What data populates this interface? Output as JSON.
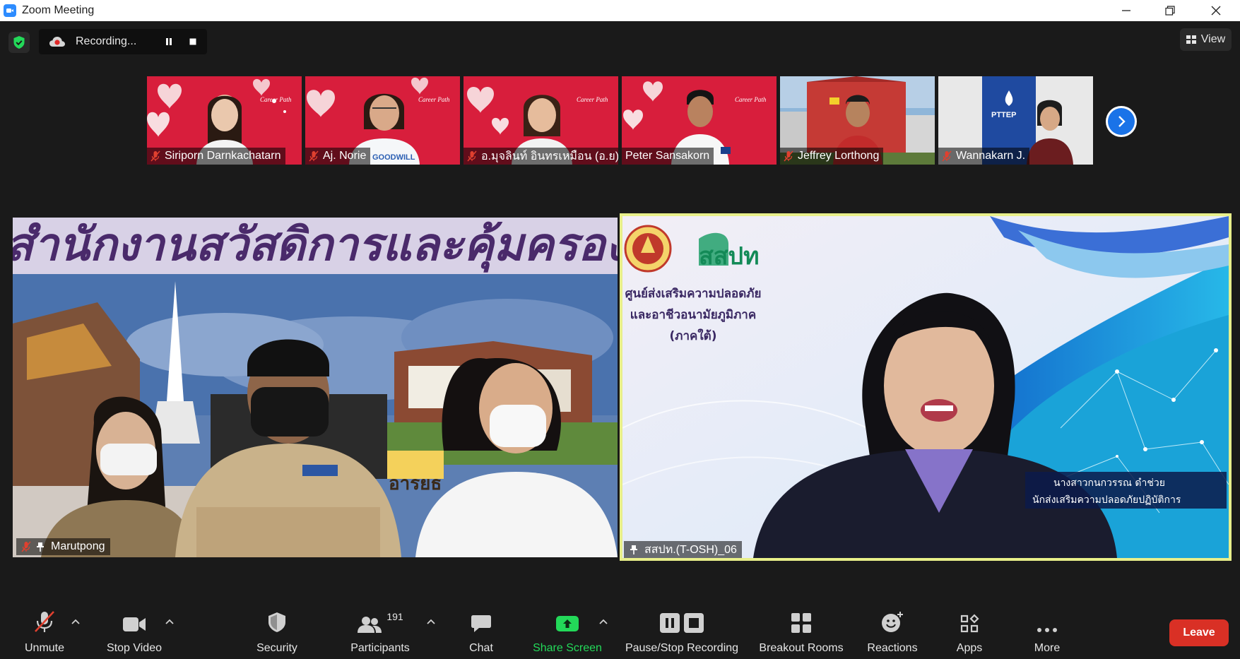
{
  "window": {
    "title": "Zoom Meeting"
  },
  "recording": {
    "status": "Recording..."
  },
  "view_button": {
    "label": "View"
  },
  "participants_strip": [
    {
      "name": "Siriporn Darnkachatarn",
      "muted": true
    },
    {
      "name": "Aj. Norie",
      "muted": true
    },
    {
      "name": "อ.มุจลินท์ อินทรเหมือน (อ.ย)",
      "muted": true
    },
    {
      "name": "Peter Sansakorn",
      "muted": false
    },
    {
      "name": "Jeffrey Lorthong",
      "muted": true
    },
    {
      "name": "Wannakarn J.",
      "muted": true
    }
  ],
  "main_videos": {
    "left": {
      "name": "Marutpong",
      "muted": true,
      "pinned": true,
      "banner_text": "สำนักงานสวัสดิการและคุ้มครองแรงงานจังหวัด",
      "sign_text": "อารยธ"
    },
    "right": {
      "name": "สสปท.(T-OSH)_06",
      "pinned": true,
      "active_speaker": true,
      "logo_text": "สสปท",
      "org_lines": [
        "ศูนย์ส่งเสริมความปลอดภัย",
        "และอาชีวอนามัยภูมิภาค",
        "(ภาคใต้)"
      ],
      "caption_name": "นางสาวกนกวรรณ ดำช่วย",
      "caption_role": "นักส่งเสริมความปลอดภัยปฏิบัติการ"
    }
  },
  "toolbar": {
    "unmute": "Unmute",
    "stop_video": "Stop Video",
    "security": "Security",
    "participants": "Participants",
    "participants_count": "191",
    "chat": "Chat",
    "share_screen": "Share Screen",
    "pause_stop_recording": "Pause/Stop Recording",
    "breakout_rooms": "Breakout Rooms",
    "reactions": "Reactions",
    "apps": "Apps",
    "more": "More",
    "leave": "Leave"
  },
  "colors": {
    "accent_blue": "#1a73e8",
    "share_green": "#23d959",
    "leave_red": "#d93025",
    "active_speaker_border": "#e8ef8a",
    "valentine_red": "#d81e3c"
  }
}
